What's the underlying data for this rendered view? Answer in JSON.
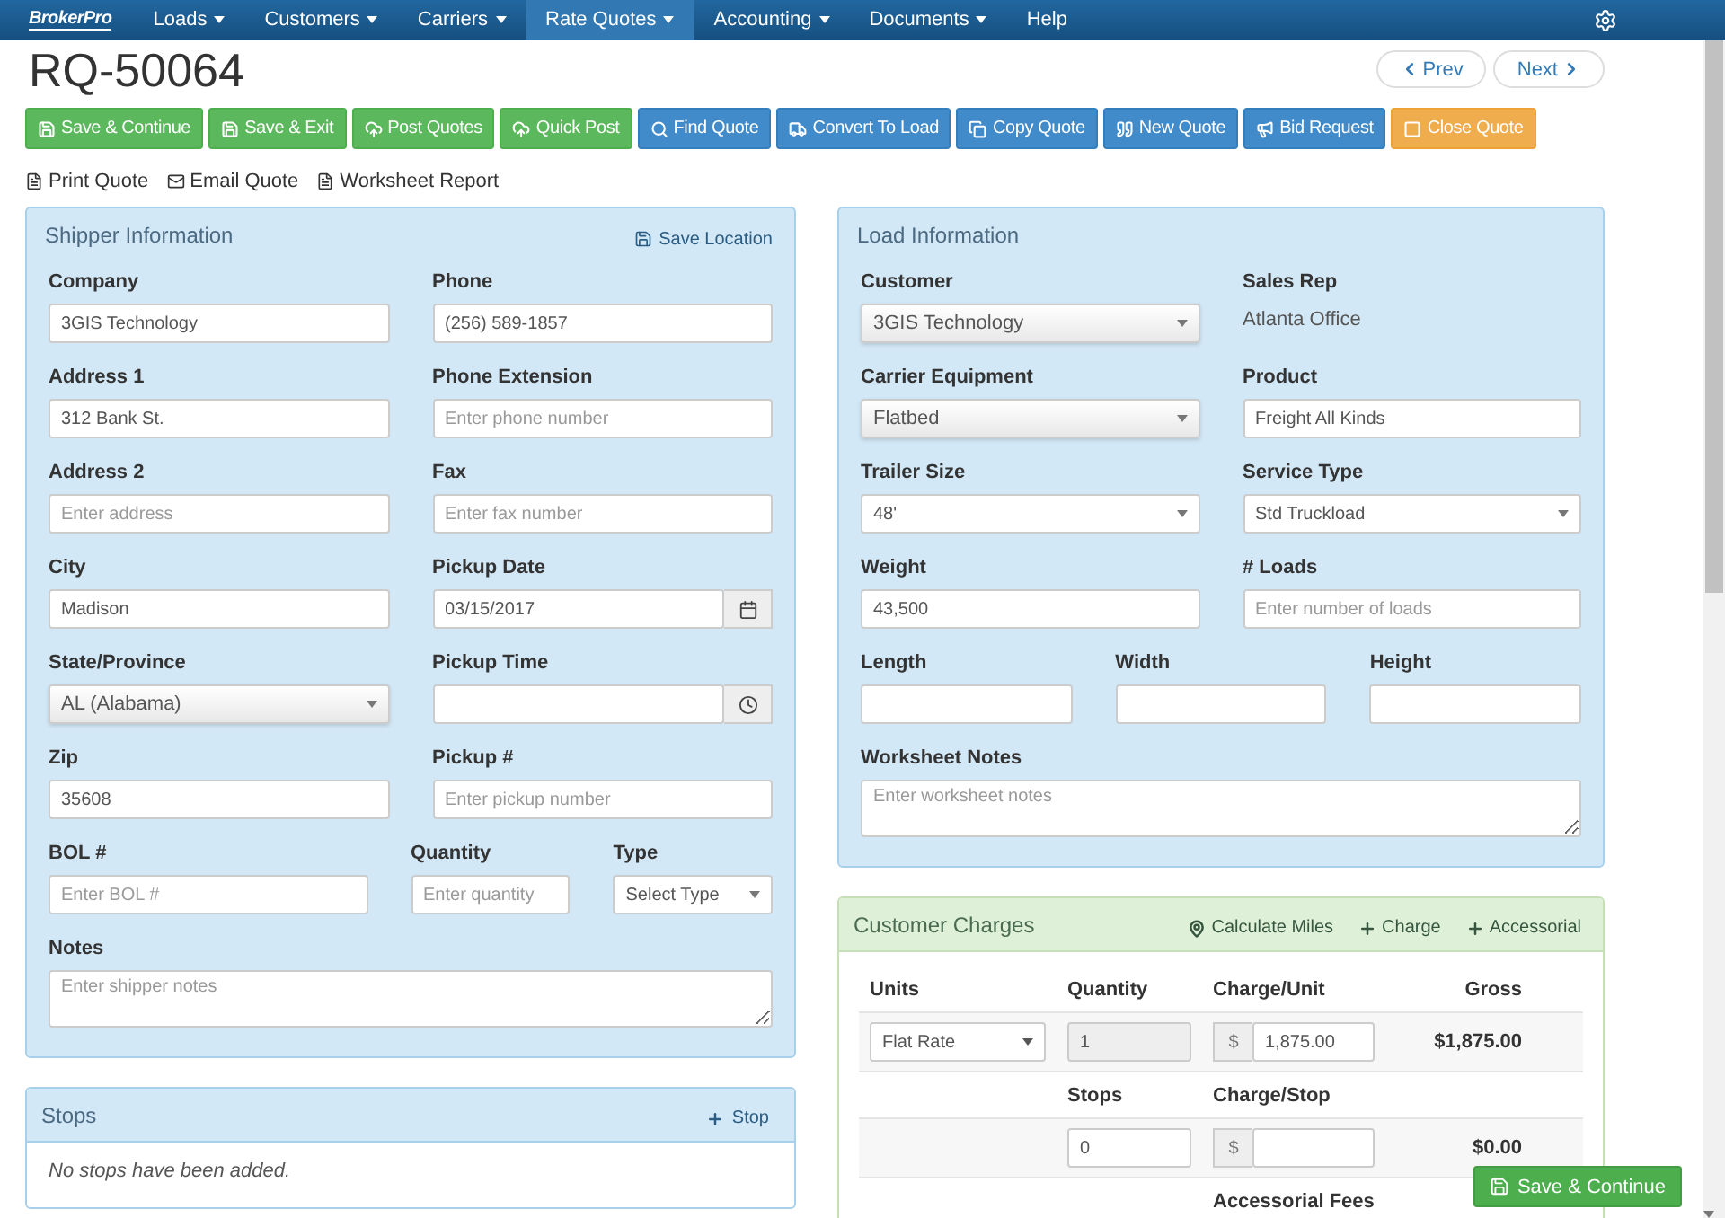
{
  "nav": {
    "logo": "BrokerPro",
    "items": [
      {
        "label": "Loads",
        "dropdown": true,
        "selected": false
      },
      {
        "label": "Customers",
        "dropdown": true,
        "selected": false
      },
      {
        "label": "Carriers",
        "dropdown": true,
        "selected": false
      },
      {
        "label": "Rate Quotes",
        "dropdown": true,
        "selected": true
      },
      {
        "label": "Accounting",
        "dropdown": true,
        "selected": false
      },
      {
        "label": "Documents",
        "dropdown": true,
        "selected": false
      },
      {
        "label": "Help",
        "dropdown": false,
        "selected": false
      }
    ]
  },
  "quote": {
    "title": "RQ-50064",
    "pager": [
      {
        "label": "Prev",
        "kind": "prev"
      },
      {
        "label": "Next",
        "kind": "next"
      }
    ]
  },
  "toolbar": [
    {
      "label": "Save & Continue",
      "kind": "success"
    },
    {
      "label": "Save & Exit",
      "kind": "success"
    },
    {
      "label": "Post Quotes",
      "kind": "success"
    },
    {
      "label": "Quick Post",
      "kind": "success"
    },
    {
      "label": "Find Quote",
      "kind": "primary"
    },
    {
      "label": "Convert To Load",
      "kind": "primary"
    },
    {
      "label": "Copy Quote",
      "kind": "primary"
    },
    {
      "label": "New Quote",
      "kind": "primary"
    },
    {
      "label": "Bid Request",
      "kind": "primary"
    },
    {
      "label": "Close Quote",
      "kind": "warning"
    }
  ],
  "links": [
    "Print Quote",
    "Email Quote",
    "Worksheet Report"
  ],
  "shipper": {
    "title": "Shipper Information",
    "action": "Save Location",
    "rows": [
      [
        {
          "label": "Company",
          "kind": "text",
          "value": "3GIS Technology"
        },
        {
          "label": "Phone",
          "kind": "text",
          "value": "(256) 589-1857"
        }
      ],
      [
        {
          "label": "Address 1",
          "kind": "text",
          "value": "312 Bank St."
        },
        {
          "label": "Phone Extension",
          "kind": "text",
          "placeholder": "Enter phone number"
        }
      ],
      [
        {
          "label": "Address 2",
          "kind": "text",
          "placeholder": "Enter address"
        },
        {
          "label": "Fax",
          "kind": "text",
          "placeholder": "Enter fax number"
        }
      ],
      [
        {
          "label": "City",
          "kind": "text",
          "value": "Madison"
        },
        {
          "label": "Pickup Date",
          "kind": "date",
          "value": "03/15/2017"
        }
      ],
      [
        {
          "label": "State/Province",
          "kind": "combo",
          "value": "AL (Alabama)"
        },
        {
          "label": "Pickup Time",
          "kind": "time"
        }
      ],
      [
        {
          "label": "Zip",
          "kind": "text",
          "value": "35608"
        },
        {
          "label": "Pickup #",
          "kind": "text",
          "placeholder": "Enter pickup number"
        }
      ],
      [
        {
          "label": "BOL #",
          "kind": "text",
          "placeholder": "Enter BOL #"
        },
        {
          "label": "Quantity",
          "kind": "text",
          "placeholder": "Enter quantity"
        },
        {
          "label": "Type",
          "kind": "select",
          "value": "Select Type"
        }
      ],
      [
        {
          "label": "Notes",
          "kind": "textarea",
          "placeholder": "Enter shipper notes"
        }
      ]
    ]
  },
  "load": {
    "title": "Load Information",
    "rows": [
      [
        {
          "label": "Customer",
          "kind": "combo",
          "value": "3GIS Technology"
        },
        {
          "label": "Sales Rep",
          "kind": "static",
          "value": "Atlanta Office"
        }
      ],
      [
        {
          "label": "Carrier Equipment",
          "kind": "combo",
          "value": "Flatbed"
        },
        {
          "label": "Product",
          "kind": "text",
          "value": "Freight All Kinds"
        }
      ],
      [
        {
          "label": "Trailer Size",
          "kind": "select",
          "value": "48'"
        },
        {
          "label": "Service Type",
          "kind": "select",
          "value": "Std Truckload"
        }
      ],
      [
        {
          "label": "Weight",
          "kind": "text",
          "value": "43,500"
        },
        {
          "label": "# Loads",
          "kind": "text",
          "placeholder": "Enter number of loads"
        }
      ],
      [
        {
          "label": "Length",
          "kind": "text"
        },
        {
          "label": "Width",
          "kind": "text"
        },
        {
          "label": "Height",
          "kind": "text"
        }
      ],
      [
        {
          "label": "Worksheet Notes",
          "kind": "textarea",
          "placeholder": "Enter worksheet notes"
        }
      ]
    ]
  },
  "stops": {
    "title": "Stops",
    "action": "Stop",
    "empty": "No stops have been added."
  },
  "charges": {
    "title": "Customer Charges",
    "actions": [
      {
        "label": "Calculate Miles",
        "kind": "pin"
      },
      {
        "label": "Charge",
        "kind": "add"
      },
      {
        "label": "Accessorial",
        "kind": "add"
      }
    ],
    "header": [
      "Units",
      "Quantity",
      "Charge/Unit",
      "Gross"
    ],
    "rate": {
      "unit": "Flat Rate",
      "quantity": "1",
      "quantity_disabled": true,
      "currency": "$",
      "charge": "1,875.00",
      "gross": "$1,875.00"
    },
    "stops_header": [
      "Stops",
      "Charge/Stop"
    ],
    "stops_row": {
      "count": "0",
      "currency": "$",
      "gross": "$0.00"
    },
    "accessorial_header": "Accessorial Fees"
  },
  "floating_button": {
    "label": "Save & Continue"
  }
}
